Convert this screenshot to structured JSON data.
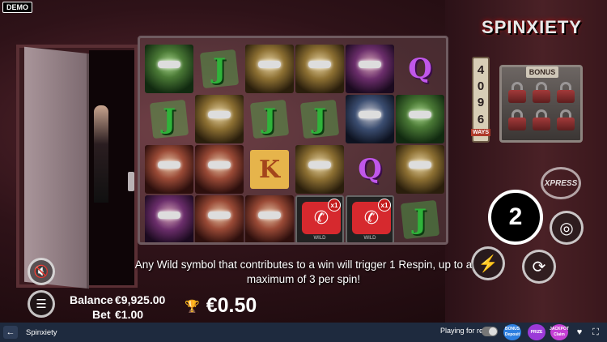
{
  "badge": {
    "demo": "DEMO"
  },
  "logo": {
    "text": "SPINXIETY",
    "x_mark": "X"
  },
  "ways_counter": {
    "digits": [
      "4",
      "0",
      "9",
      "6"
    ],
    "label": "WAYS"
  },
  "bonus": {
    "title": "BONUS",
    "locks": 6
  },
  "reels": [
    [
      {
        "t": "face",
        "c": "green"
      },
      {
        "t": "j",
        "v": "J"
      },
      {
        "t": "face",
        "c": "red"
      },
      {
        "t": "face",
        "c": "purple"
      }
    ],
    [
      {
        "t": "j",
        "v": "J"
      },
      {
        "t": "face",
        "c": "gold"
      },
      {
        "t": "face",
        "c": "red"
      },
      {
        "t": "face",
        "c": "red"
      }
    ],
    [
      {
        "t": "face",
        "c": "gold"
      },
      {
        "t": "j",
        "v": "J"
      },
      {
        "t": "k",
        "v": "K"
      },
      {
        "t": "face",
        "c": "red"
      }
    ],
    [
      {
        "t": "face",
        "c": "gold"
      },
      {
        "t": "j",
        "v": "J"
      },
      {
        "t": "face",
        "c": "gold"
      },
      {
        "t": "wild",
        "mult": "x1",
        "tag": "WILD"
      }
    ],
    [
      {
        "t": "face",
        "c": "purple"
      },
      {
        "t": "face",
        "c": "blue"
      },
      {
        "t": "q",
        "v": "Q"
      },
      {
        "t": "wild",
        "mult": "x1",
        "tag": "WILD"
      }
    ],
    [
      {
        "t": "q",
        "v": "Q"
      },
      {
        "t": "face",
        "c": "green"
      },
      {
        "t": "face",
        "c": "gold"
      },
      {
        "t": "j",
        "v": "J"
      }
    ]
  ],
  "controls": {
    "xpress": "XPRESS",
    "spin_count": "2",
    "mute_icon": "speaker-mute-icon",
    "menu_icon": "hamburger-menu-icon",
    "turbo_icon": "lightning-icon",
    "autoplay_icon": "autoplay-arrows-icon",
    "bet_icon": "coin-stack-icon"
  },
  "info_text": "Any Wild symbol that contributes to a win will trigger 1 Respin, up to a maximum of 3 per spin!",
  "wallet": {
    "balance_label": "Balance",
    "balance_value": "€9,925.00",
    "bet_label": "Bet",
    "bet_value": "€1.00"
  },
  "win": {
    "amount": "€0.50"
  },
  "bottom_bar": {
    "game_name": "Spinxiety",
    "playing_for_real": "Playing for real",
    "promos": [
      {
        "top": "BONUS",
        "bottom": "Deposit",
        "color": "#2d7fe0"
      },
      {
        "top": "PRIZE",
        "bottom": "",
        "color": "#9b3ad8"
      },
      {
        "top": "JACKPOT",
        "bottom": "Claim",
        "color": "#c43fd4"
      }
    ]
  },
  "colors": {
    "accent_red": "#c81b1b",
    "bottom_bar": "#1e2a3e",
    "wild_red": "#d6292e"
  }
}
